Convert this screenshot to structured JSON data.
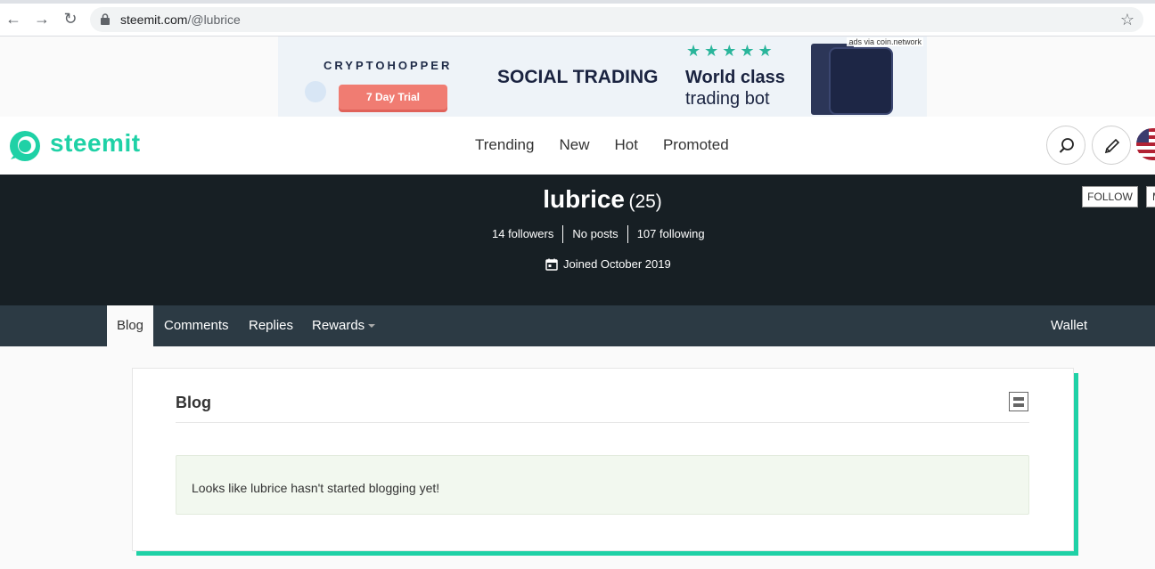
{
  "browser": {
    "url_domain": "steemit.com",
    "url_path": "/@lubrice"
  },
  "ad": {
    "brand": "CRYPTOHOPPER",
    "trial_button": "7 Day Trial",
    "headline": "SOCIAL TRADING",
    "stars": "★★★★★",
    "tagline_line1": "World class",
    "tagline_line2": "trading bot",
    "ads_via": "ads via coin.network"
  },
  "header": {
    "logo_text": "steemit",
    "nav": [
      "Trending",
      "New",
      "Hot",
      "Promoted"
    ],
    "colors": {
      "brand": "#1fd1a6",
      "banner": "#171f24",
      "tabbar": "#2c3a44"
    }
  },
  "profile": {
    "username": "lubrice",
    "reputation": "(25)",
    "followers": "14 followers",
    "posts": "No posts",
    "following": "107 following",
    "joined": "Joined October 2019",
    "follow_button": "FOLLOW",
    "mute_button": "MUTE"
  },
  "tabs": {
    "items": [
      "Blog",
      "Comments",
      "Replies",
      "Rewards"
    ],
    "wallet": "Wallet"
  },
  "content": {
    "title": "Blog",
    "empty_message": "Looks like lubrice hasn't started blogging yet!"
  }
}
